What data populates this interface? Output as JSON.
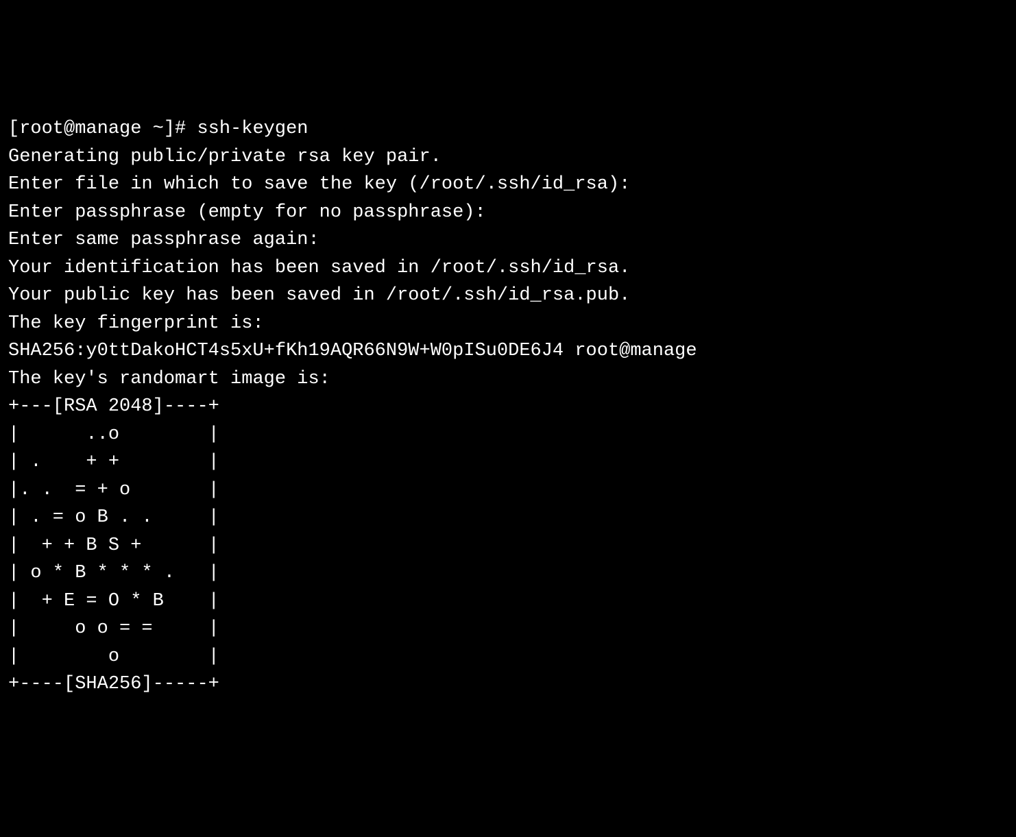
{
  "terminal": {
    "prompt": "[root@manage ~]# ",
    "command": "ssh-keygen",
    "lines": [
      "Generating public/private rsa key pair.",
      "Enter file in which to save the key (/root/.ssh/id_rsa):",
      "Enter passphrase (empty for no passphrase):",
      "Enter same passphrase again:",
      "Your identification has been saved in /root/.ssh/id_rsa.",
      "Your public key has been saved in /root/.ssh/id_rsa.pub.",
      "The key fingerprint is:",
      "SHA256:y0ttDakoHCT4s5xU+fKh19AQR66N9W+W0pISu0DE6J4 root@manage",
      "The key's randomart image is:",
      "+---[RSA 2048]----+",
      "|      ..o        |",
      "| .    + +        |",
      "|. .  = + o       |",
      "| . = o B . .     |",
      "|  + + B S +      |",
      "| o * B * * * .   |",
      "|  + E = O * B    |",
      "|     o o = =     |",
      "|        o        |",
      "+----[SHA256]-----+"
    ]
  }
}
